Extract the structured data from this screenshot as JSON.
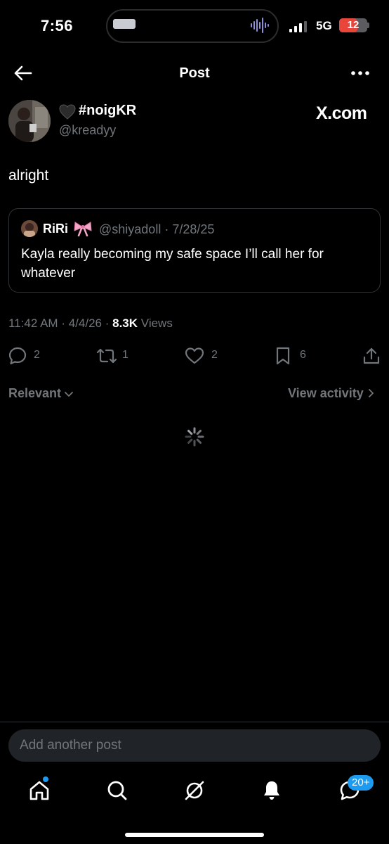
{
  "status_bar": {
    "time": "7:56",
    "network": "5G",
    "battery": "12"
  },
  "header": {
    "title": "Post"
  },
  "post": {
    "display_name": "#noigKR",
    "handle": "@kreadyy",
    "brand": "X.com",
    "text": "alright",
    "time": "11:42 AM",
    "date": "4/4/26",
    "views_count": "8.3K",
    "views_label": "Views",
    "dot": "·"
  },
  "quote": {
    "name": "RiRi",
    "handle": "@shiyadoll",
    "date": "7/28/25",
    "text": "Kayla really becoming my safe space I’ll call her for whatever"
  },
  "actions": {
    "replies": "2",
    "reposts": "1",
    "likes": "2",
    "bookmarks": "6"
  },
  "replies_bar": {
    "sort_label": "Relevant",
    "activity_label": "View activity"
  },
  "composer": {
    "placeholder": "Add another post"
  },
  "tab_bar": {
    "messages_badge": "20+"
  },
  "colors": {
    "background": "#000000",
    "accent": "#1d9bf0",
    "muted_text": "#71767b",
    "battery_low": "#e9453a"
  },
  "icons": [
    "back-arrow-icon",
    "more-icon",
    "black-heart-icon",
    "bow-icon",
    "reply-icon",
    "repost-icon",
    "like-icon",
    "bookmark-icon",
    "share-icon",
    "chevron-down-icon",
    "chevron-right-icon",
    "loading-spinner-icon",
    "home-icon",
    "search-icon",
    "grok-icon",
    "bell-icon",
    "messages-icon"
  ]
}
